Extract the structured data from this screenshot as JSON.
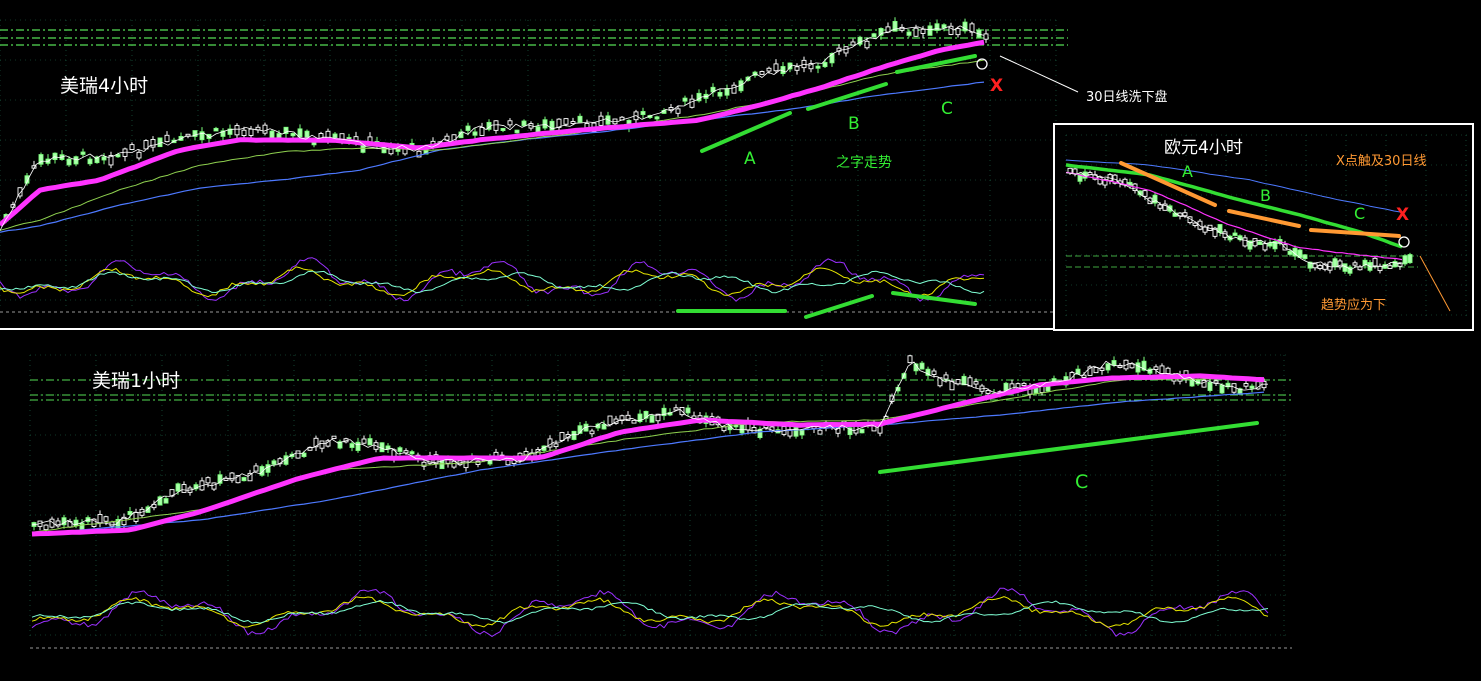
{
  "chart_data": [
    {
      "type": "line",
      "title": "美瑞4小时",
      "annotations": {
        "wave_labels": [
          "A",
          "B",
          "C"
        ],
        "x_marker": "X",
        "pattern_label": "之字走势",
        "callout": "30日线洗下盘"
      }
    },
    {
      "type": "line",
      "title": "欧元4小时",
      "annotations": {
        "wave_labels": [
          "A",
          "B",
          "C"
        ],
        "x_marker": "X",
        "note_top": "X点触及30日线",
        "note_bottom": "趋势应为下"
      }
    },
    {
      "type": "line",
      "title": "美瑞1小时",
      "annotations": {
        "wave_labels": [
          "C"
        ]
      }
    }
  ],
  "colors": {
    "background": "#000000",
    "ma_thick": "#ff33ff",
    "ma_thin": "#8fd14f",
    "ma_blue": "#4d79ff",
    "ma_white": "#ffffff",
    "trend_green": "#33dd33",
    "trend_orange": "#ff9933",
    "grid": "#1f6f4f",
    "x_marker": "#ff2020",
    "osc_purple": "#9b30ff",
    "osc_yellow": "#e6e600",
    "osc_cyan": "#7fffd4"
  }
}
